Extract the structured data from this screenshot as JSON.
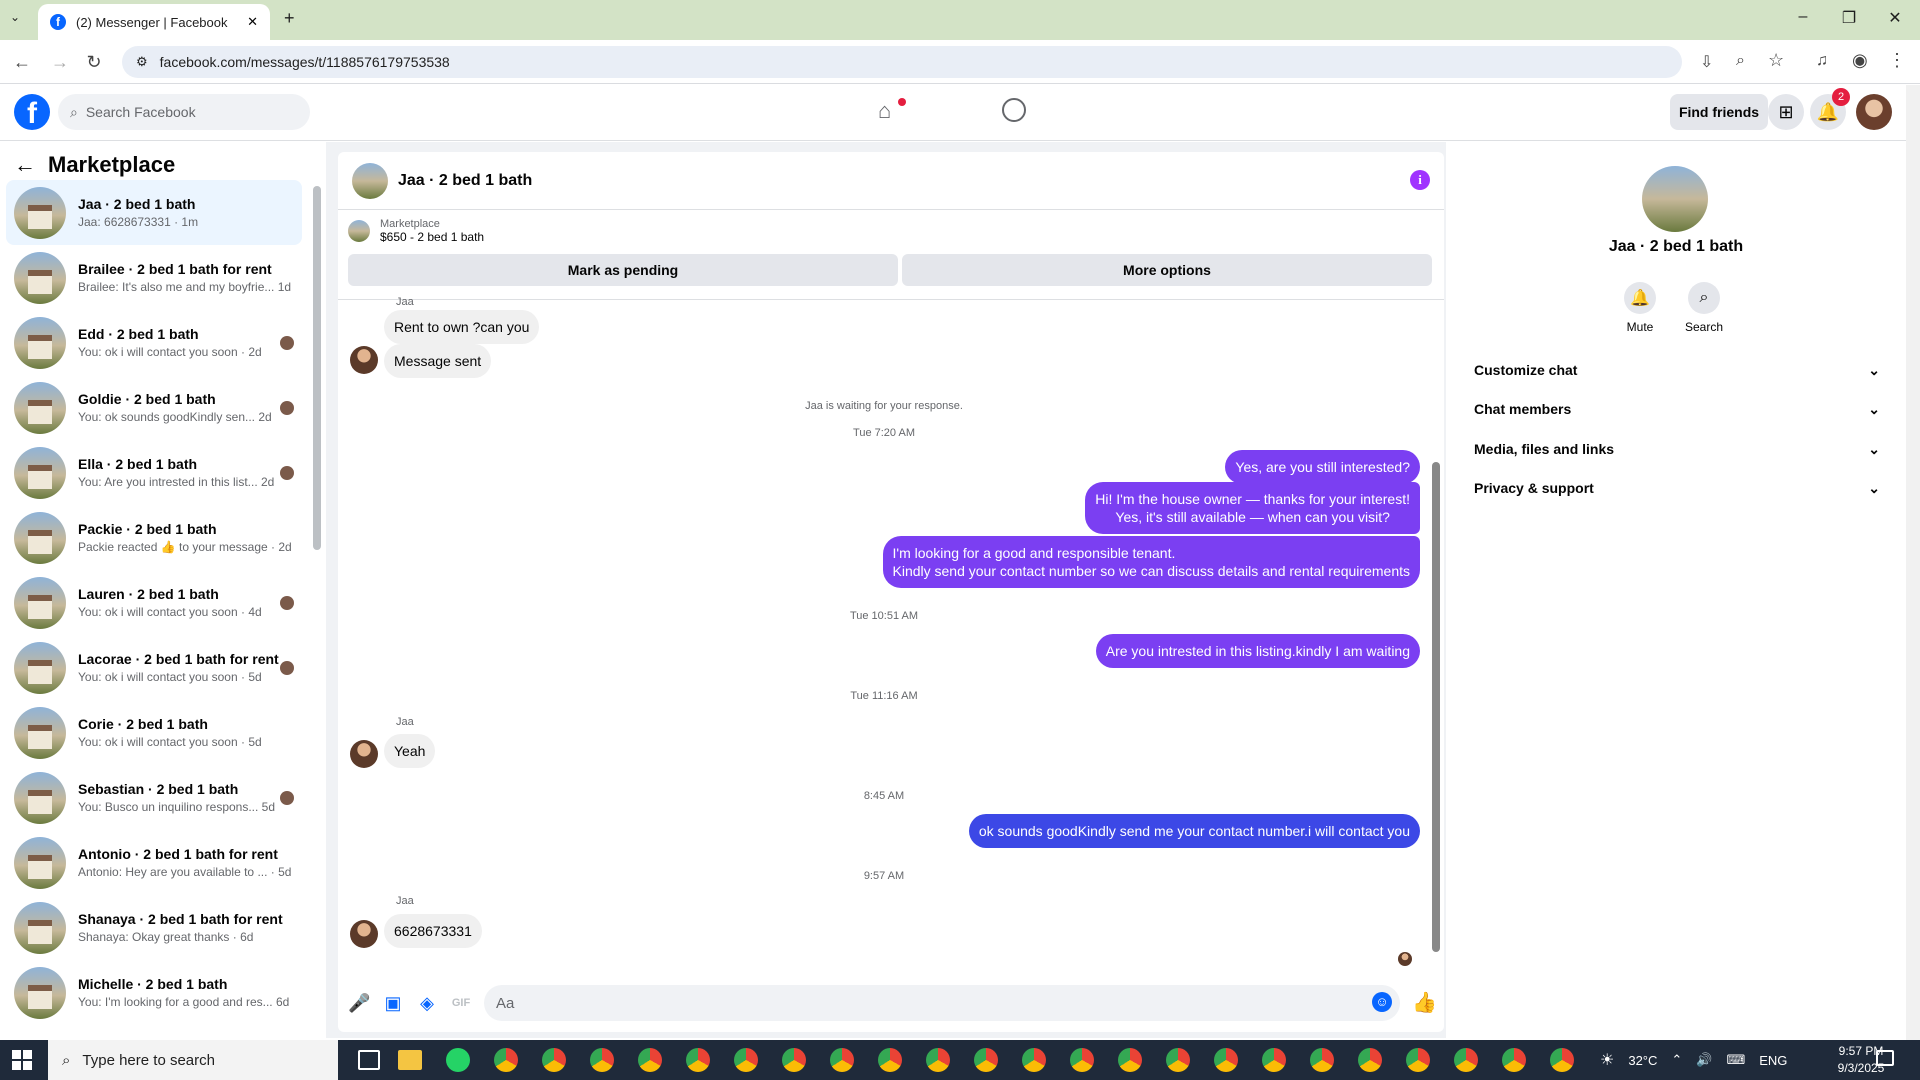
{
  "browser": {
    "tab_title": "(2) Messenger | Facebook",
    "url": "facebook.com/messages/t/1188576179753538"
  },
  "fb_header": {
    "search_placeholder": "Search Facebook",
    "find_friends": "Find friends",
    "notif_count": "2"
  },
  "sidebar": {
    "title": "Marketplace",
    "items": [
      {
        "name": "Jaa · 2 bed 1 bath",
        "preview": "Jaa: 6628673331 · 1m"
      },
      {
        "name": "Brailee · 2 bed 1 bath for rent",
        "preview": "Brailee: It's also me and my boyfrie...   1d"
      },
      {
        "name": "Edd · 2 bed 1 bath",
        "preview": "You: ok i will contact you soon · 2d"
      },
      {
        "name": "Goldie · 2 bed 1 bath",
        "preview": "You: ok sounds goodKindly sen...   2d"
      },
      {
        "name": "Ella · 2 bed 1 bath",
        "preview": "You: Are you intrested in this list...   2d"
      },
      {
        "name": "Packie · 2 bed 1 bath",
        "preview": "Packie reacted 👍 to your message · 2d"
      },
      {
        "name": "Lauren · 2 bed 1 bath",
        "preview": "You: ok i will contact you soon · 4d"
      },
      {
        "name": "Lacorae · 2 bed 1 bath for rent",
        "preview": "You: ok i will contact you soon · 5d"
      },
      {
        "name": "Corie · 2 bed 1 bath",
        "preview": "You: ok i will contact you soon · 5d"
      },
      {
        "name": "Sebastian · 2 bed 1 bath",
        "preview": "You: Busco un inquilino respons...   5d"
      },
      {
        "name": "Antonio · 2 bed 1 bath for rent",
        "preview": "Antonio: Hey are you available to ... · 5d"
      },
      {
        "name": "Shanaya · 2 bed 1 bath for rent",
        "preview": "Shanaya: Okay great thanks · 6d"
      },
      {
        "name": "Michelle · 2 bed 1 bath",
        "preview": "You: I'm looking for a good and res...   6d"
      }
    ]
  },
  "chat": {
    "name": "Jaa · 2 bed 1 bath",
    "marketplace_label": "Marketplace",
    "listing": "$650 - 2 bed 1 bath",
    "mark_pending": "Mark as pending",
    "more_options": "More options",
    "sender_name": "Jaa",
    "msg_rent": "Rent to own ?can you",
    "msg_sent": "Message sent",
    "waiting": "Jaa is waiting for your response.",
    "ts1": "Tue 7:20 AM",
    "out1": "Yes, are you still interested?",
    "out2a": "Hi! I'm the house owner — thanks for your interest!",
    "out2b": "Yes, it's still available — when can you visit?",
    "out3a": "I'm looking for a good and responsible tenant.",
    "out3b": "Kindly send your contact number so we can discuss details and rental requirements",
    "ts2": "Tue 10:51 AM",
    "out4": "Are you intrested in this listing.kindly I am waiting",
    "ts3": "Tue 11:16 AM",
    "in_yeah": "Yeah",
    "ts4": "8:45 AM",
    "out5": "ok sounds goodKindly send me your contact number.i will contact you",
    "ts5": "9:57 AM",
    "in_number": "6628673331",
    "composer_placeholder": "Aa"
  },
  "right_panel": {
    "name": "Jaa · 2 bed 1 bath",
    "mute": "Mute",
    "search": "Search",
    "sections": [
      "Customize chat",
      "Chat members",
      "Media, files and links",
      "Privacy & support"
    ]
  },
  "taskbar": {
    "search_placeholder": "Type here to search",
    "temp": "32°C",
    "lang": "ENG",
    "time": "9:57 PM",
    "date": "9/3/2025"
  }
}
